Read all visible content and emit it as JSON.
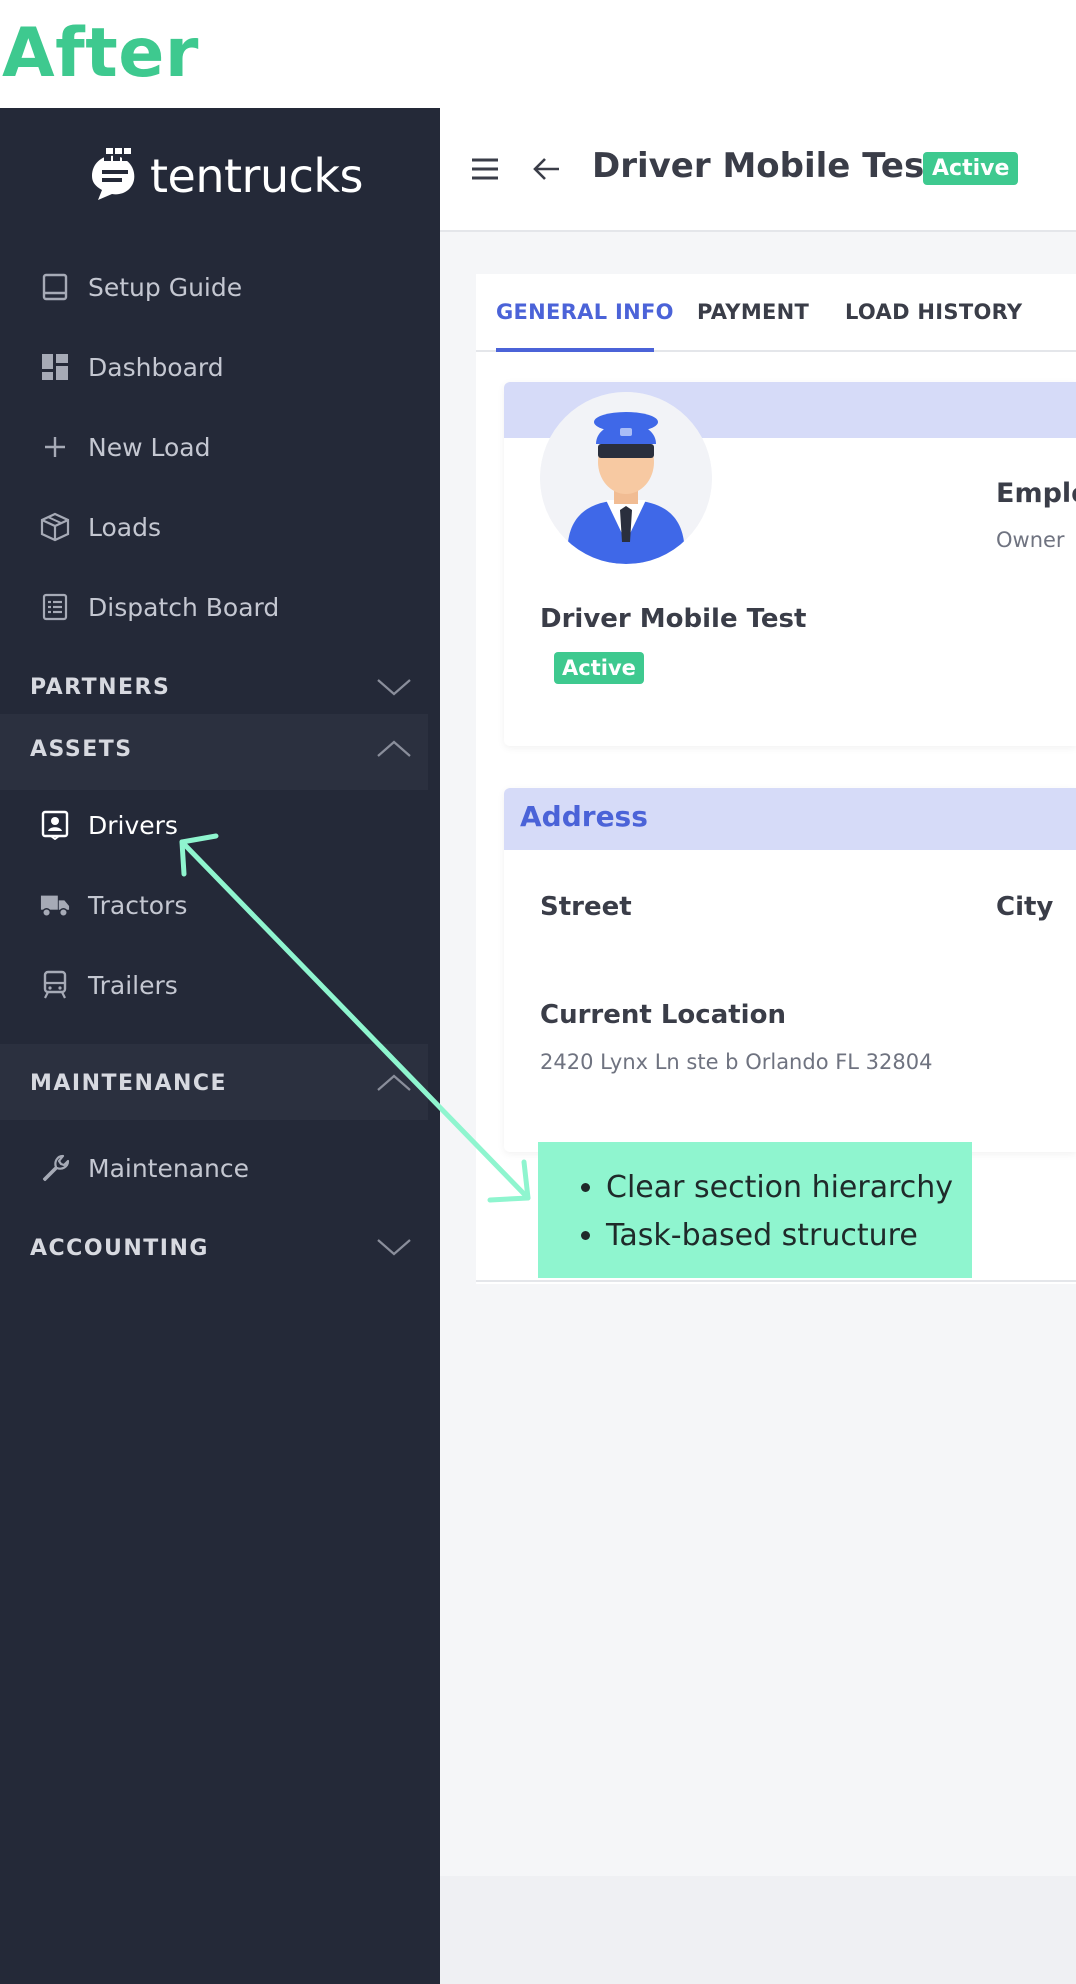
{
  "page_label": "After",
  "brand": {
    "logo_text": "tentrucks"
  },
  "sidebar": {
    "items": [
      {
        "label": "Setup Guide",
        "icon": "book-icon"
      },
      {
        "label": "Dashboard",
        "icon": "dashboard-grid-icon"
      },
      {
        "label": "New Load",
        "icon": "plus-icon"
      },
      {
        "label": "Loads",
        "icon": "box-icon"
      },
      {
        "label": "Dispatch Board",
        "icon": "list-board-icon"
      }
    ],
    "sections": {
      "partners": {
        "title": "PARTNERS",
        "expanded": false
      },
      "assets": {
        "title": "ASSETS",
        "expanded": true,
        "items": [
          {
            "label": "Drivers",
            "icon": "driver-badge-icon",
            "active": true
          },
          {
            "label": "Tractors",
            "icon": "truck-icon"
          },
          {
            "label": "Trailers",
            "icon": "trailer-icon"
          }
        ]
      },
      "maintenance": {
        "title": "MAINTENANCE",
        "expanded": true,
        "items": [
          {
            "label": "Maintenance",
            "icon": "wrench-icon"
          }
        ]
      },
      "accounting": {
        "title": "ACCOUNTING",
        "expanded": false
      }
    }
  },
  "header": {
    "title": "Driver Mobile Test",
    "status": "Active"
  },
  "tabs": [
    {
      "label": "GENERAL INFO",
      "active": true
    },
    {
      "label": "PAYMENT",
      "active": false
    },
    {
      "label": "LOAD HISTORY",
      "active": false
    }
  ],
  "profile_card": {
    "driver_name": "Driver Mobile Test",
    "status": "Active",
    "employment_label": "Emplo",
    "employment_value": "Owner"
  },
  "address_card": {
    "title": "Address",
    "street_label": "Street",
    "city_label": "City",
    "current_location_label": "Current Location",
    "current_location_value": "2420 Lynx Ln ste b Orlando FL 32804"
  },
  "callout": {
    "bullets": [
      "Clear section hierarchy",
      "Task-based structure"
    ]
  },
  "colors": {
    "sidebar_bg": "#242938",
    "accent_blue": "#4b63d8",
    "status_green": "#3ec98f",
    "callout_bg": "#8ff5cf",
    "card_header_bg": "#d6dbf8"
  }
}
